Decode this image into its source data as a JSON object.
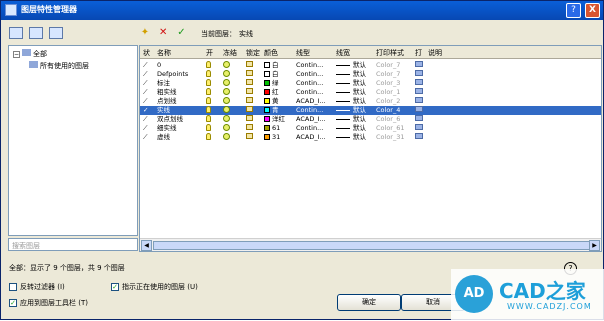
{
  "window": {
    "title": "图层特性管理器",
    "help": "?",
    "close": "X"
  },
  "current_layer": {
    "label": "当前图层：",
    "value": "实线"
  },
  "tree": {
    "root": "全部",
    "child": "所有使用的图层",
    "search_placeholder": "搜索图层"
  },
  "columns": [
    "状",
    "名称",
    "开",
    "冻结",
    "锁定",
    "颜色",
    "线型",
    "线宽",
    "打印样式",
    "打",
    "说明"
  ],
  "layers": [
    {
      "name": "0",
      "color_name": "白",
      "color_hex": "#ffffff",
      "linetype": "Contin...",
      "lineweight": "默认",
      "plotstyle": "Color_7",
      "current": false
    },
    {
      "name": "Defpoints",
      "color_name": "白",
      "color_hex": "#ffffff",
      "linetype": "Contin...",
      "lineweight": "默认",
      "plotstyle": "Color_7",
      "current": false
    },
    {
      "name": "标注",
      "color_name": "绿",
      "color_hex": "#00c000",
      "linetype": "Contin...",
      "lineweight": "默认",
      "plotstyle": "Color_3",
      "current": false
    },
    {
      "name": "粗实线",
      "color_name": "红",
      "color_hex": "#ff0000",
      "linetype": "Contin...",
      "lineweight": "默认",
      "plotstyle": "Color_1",
      "current": false
    },
    {
      "name": "点划线",
      "color_name": "黄",
      "color_hex": "#ffff00",
      "linetype": "ACAD_I...",
      "lineweight": "默认",
      "plotstyle": "Color_2",
      "current": false
    },
    {
      "name": "实线",
      "color_name": "青",
      "color_hex": "#00ffff",
      "linetype": "Contin...",
      "lineweight": "默认",
      "plotstyle": "Color_4",
      "current": true
    },
    {
      "name": "双点划线",
      "color_name": "洋红",
      "color_hex": "#ff00ff",
      "linetype": "ACAD_I...",
      "lineweight": "默认",
      "plotstyle": "Color_6",
      "current": false
    },
    {
      "name": "细实线",
      "color_name": "61",
      "color_hex": "#a5a500",
      "linetype": "Contin...",
      "lineweight": "默认",
      "plotstyle": "Color_61",
      "current": false
    },
    {
      "name": "虚线",
      "color_name": "31",
      "color_hex": "#ff9f00",
      "linetype": "ACAD_I...",
      "lineweight": "默认",
      "plotstyle": "Color_31",
      "current": false
    }
  ],
  "status": "全部：显示了 9 个图层，共 9 个图层",
  "options": {
    "invert_filter": "反转过滤器 (I)",
    "show_in_use": "指示正在使用的图层 (U)",
    "apply_toolbar": "应用到图层工具栏 (T)"
  },
  "buttons": {
    "ok": "确定",
    "cancel": "取消"
  },
  "help_circle": "?",
  "watermark": {
    "logo": "AD",
    "name": "CAD之家",
    "url": "WWW.CADZJ.COM"
  }
}
